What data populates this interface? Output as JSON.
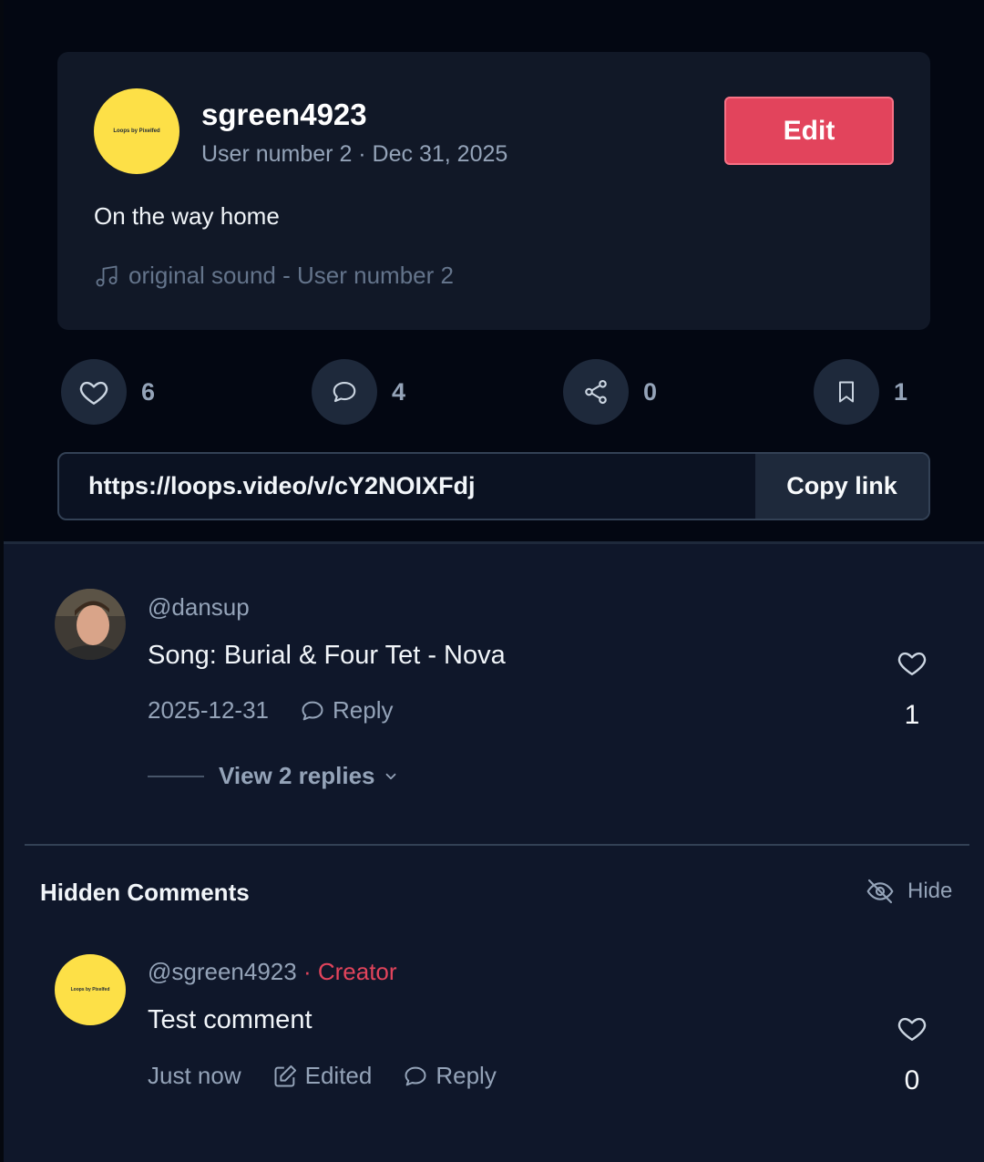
{
  "post": {
    "avatar_text": "Loops by Pixelfed",
    "username": "sgreen4923",
    "subline": "User number 2 · Dec 31, 2025",
    "edit_label": "Edit",
    "caption": "On the way home",
    "sound": "original sound - User number 2",
    "icon": "music-note-icon"
  },
  "actions": {
    "likes": "6",
    "comments": "4",
    "shares": "0",
    "bookmarks": "1"
  },
  "share_link": {
    "url": "https://loops.video/v/cY2NOIXFdj",
    "copy_label": "Copy link"
  },
  "comments": [
    {
      "handle": "@dansup",
      "text": "Song: Burial & Four Tet - Nova",
      "date": "2025-12-31",
      "reply_label": "Reply",
      "likes": "1",
      "view_replies": "View 2 replies"
    }
  ],
  "hidden_section": {
    "title": "Hidden Comments",
    "hide_label": "Hide",
    "comments": [
      {
        "avatar_text": "Loops by Pixelfed",
        "handle": "@sgreen4923",
        "separator": " · ",
        "badge": "Creator",
        "text": "Test comment",
        "time": "Just now",
        "edited_label": "Edited",
        "reply_label": "Reply",
        "likes": "0"
      }
    ]
  },
  "colors": {
    "accent": "#e2445c",
    "avatar_yellow": "#fde047",
    "background": "#0f172a"
  }
}
